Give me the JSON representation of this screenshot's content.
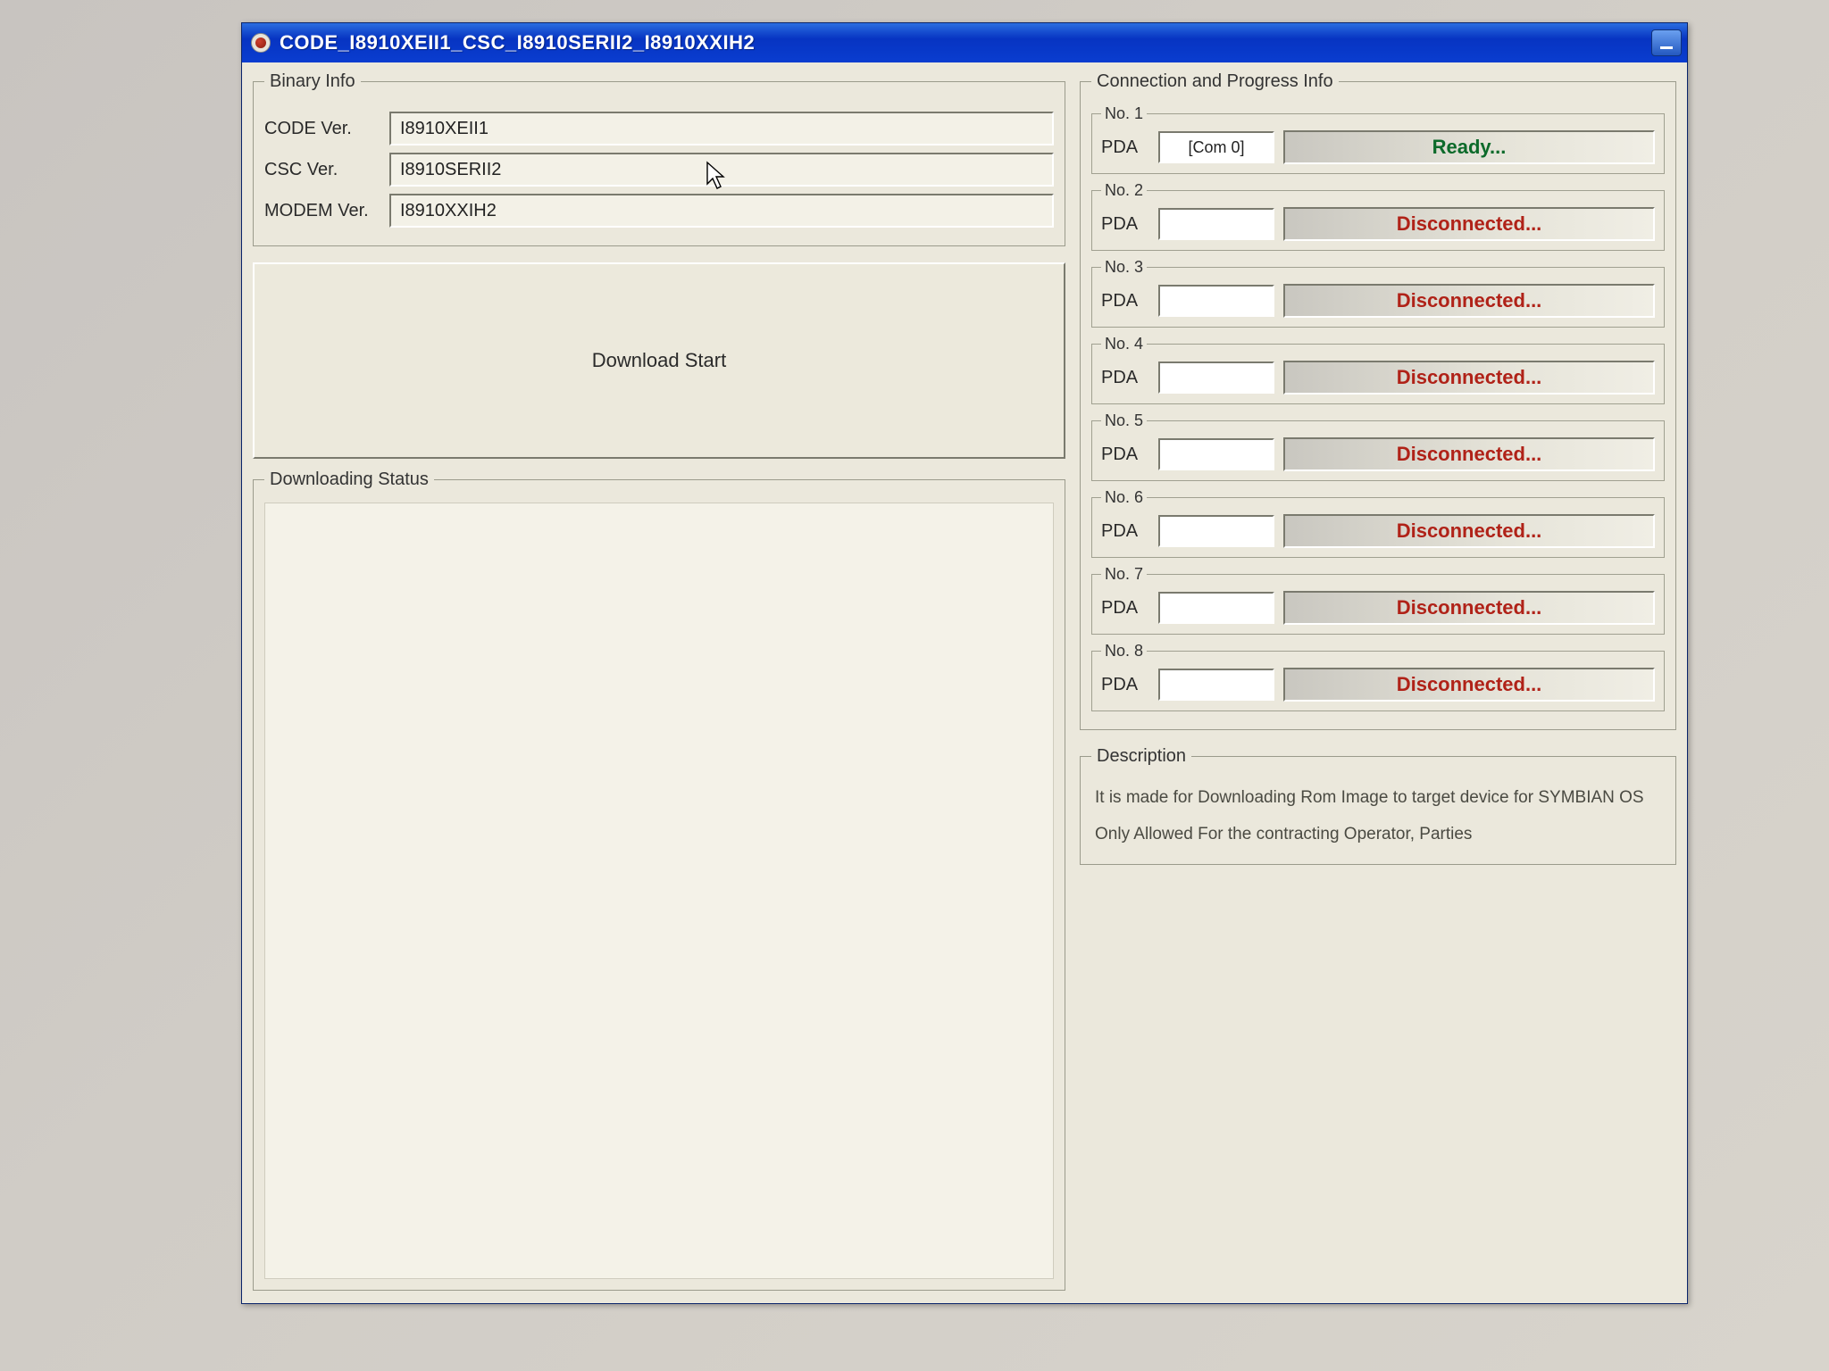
{
  "window": {
    "title": "CODE_I8910XEII1_CSC_I8910SERII2_I8910XXIH2"
  },
  "binary_info": {
    "legend": "Binary Info",
    "code_label": "CODE Ver.",
    "code_value": "I8910XEII1",
    "csc_label": "CSC Ver.",
    "csc_value": "I8910SERII2",
    "modem_label": "MODEM Ver.",
    "modem_value": "I8910XXIH2"
  },
  "download_button": "Download Start",
  "downloading_status": {
    "legend": "Downloading Status"
  },
  "connection": {
    "legend": "Connection and Progress Info",
    "pda_label": "PDA",
    "slots": [
      {
        "num": "No. 1",
        "com": "[Com 0]",
        "status": "Ready...",
        "state": "ready"
      },
      {
        "num": "No. 2",
        "com": "",
        "status": "Disconnected...",
        "state": "disc"
      },
      {
        "num": "No. 3",
        "com": "",
        "status": "Disconnected...",
        "state": "disc"
      },
      {
        "num": "No. 4",
        "com": "",
        "status": "Disconnected...",
        "state": "disc"
      },
      {
        "num": "No. 5",
        "com": "",
        "status": "Disconnected...",
        "state": "disc"
      },
      {
        "num": "No. 6",
        "com": "",
        "status": "Disconnected...",
        "state": "disc"
      },
      {
        "num": "No. 7",
        "com": "",
        "status": "Disconnected...",
        "state": "disc"
      },
      {
        "num": "No. 8",
        "com": "",
        "status": "Disconnected...",
        "state": "disc"
      }
    ]
  },
  "description": {
    "legend": "Description",
    "line1": "It is made for Downloading Rom Image to target device for SYMBIAN OS",
    "line2": "Only Allowed For the contracting Operator, Parties"
  }
}
